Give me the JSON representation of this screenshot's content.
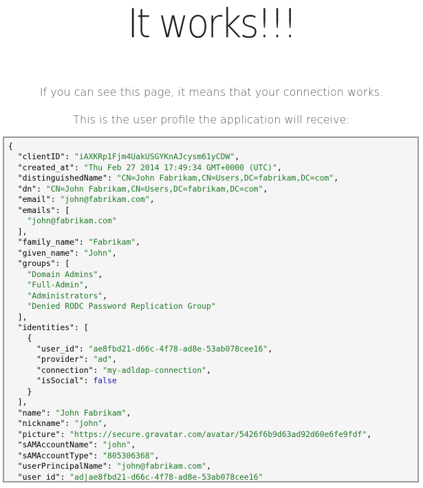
{
  "header": {
    "title": "It works!!!",
    "line1": "If you can see this page, it means that your connection works.",
    "line2": "This is the user profile the application will receive:"
  },
  "profile": {
    "clientID": "iAXKRp1Fjm4UakUSGYKnAJcysm61yCDW",
    "created_at": "Thu Feb 27 2014 17:49:34 GMT+0000 (UTC)",
    "distinguishedName": "CN=John Fabrikam,CN=Users,DC=fabrikam,DC=com",
    "dn": "CN=John Fabrikam,CN=Users,DC=fabrikam,DC=com",
    "email": "john@fabrikam.com",
    "emails": [
      "john@fabrikam.com"
    ],
    "family_name": "Fabrikam",
    "given_name": "John",
    "groups": [
      "Domain Admins",
      "Full-Admin",
      "Administrators",
      "Denied RODC Password Replication Group"
    ],
    "identities": [
      {
        "user_id": "ae8fbd21-d66c-4f78-ad8e-53ab078cee16",
        "provider": "ad",
        "connection": "my-adldap-connection",
        "isSocial": false
      }
    ],
    "name": "John Fabrikam",
    "nickname": "john",
    "picture": "https://secure.gravatar.com/avatar/5426f6b9d63ad92d60e6fe9fdf",
    "sAMAccountName": "john",
    "sAMAccountType": "805306368",
    "userPrincipalName": "john@fabrikam.com",
    "user_id": "ad|ae8fbd21-d66c-4f78-ad8e-53ab078cee16"
  }
}
